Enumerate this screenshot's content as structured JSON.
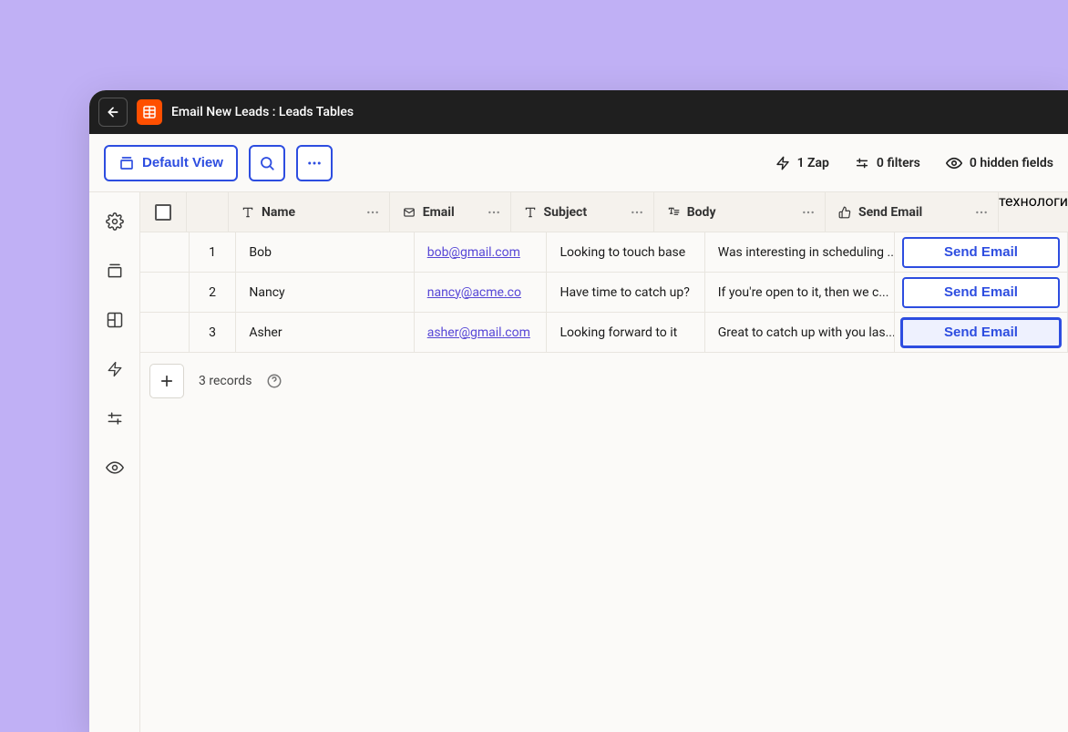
{
  "header": {
    "breadcrumb": "Email New Leads : Leads Tables"
  },
  "toolbar": {
    "default_view_label": "Default View",
    "zap_count": "1 Zap",
    "filters": "0 filters",
    "hidden_fields": "0 hidden fields"
  },
  "columns": {
    "name": "Name",
    "email": "Email",
    "subject": "Subject",
    "body": "Body",
    "action": "Send Email"
  },
  "rows": [
    {
      "num": "1",
      "name": "Bob",
      "email": "bob@gmail.com",
      "subject": "Looking to touch base",
      "body": "Was interesting in scheduling ...",
      "action": "Send Email"
    },
    {
      "num": "2",
      "name": "Nancy",
      "email": "nancy@acme.co",
      "subject": "Have time to catch up?",
      "body": "If you're open to it, then we c...",
      "action": "Send Email"
    },
    {
      "num": "3",
      "name": "Asher",
      "email": "asher@gmail.com",
      "subject": "Looking forward to it",
      "body": "Great to catch up with you las...",
      "action": "Send Email"
    }
  ],
  "footer": {
    "records": "3 records"
  }
}
